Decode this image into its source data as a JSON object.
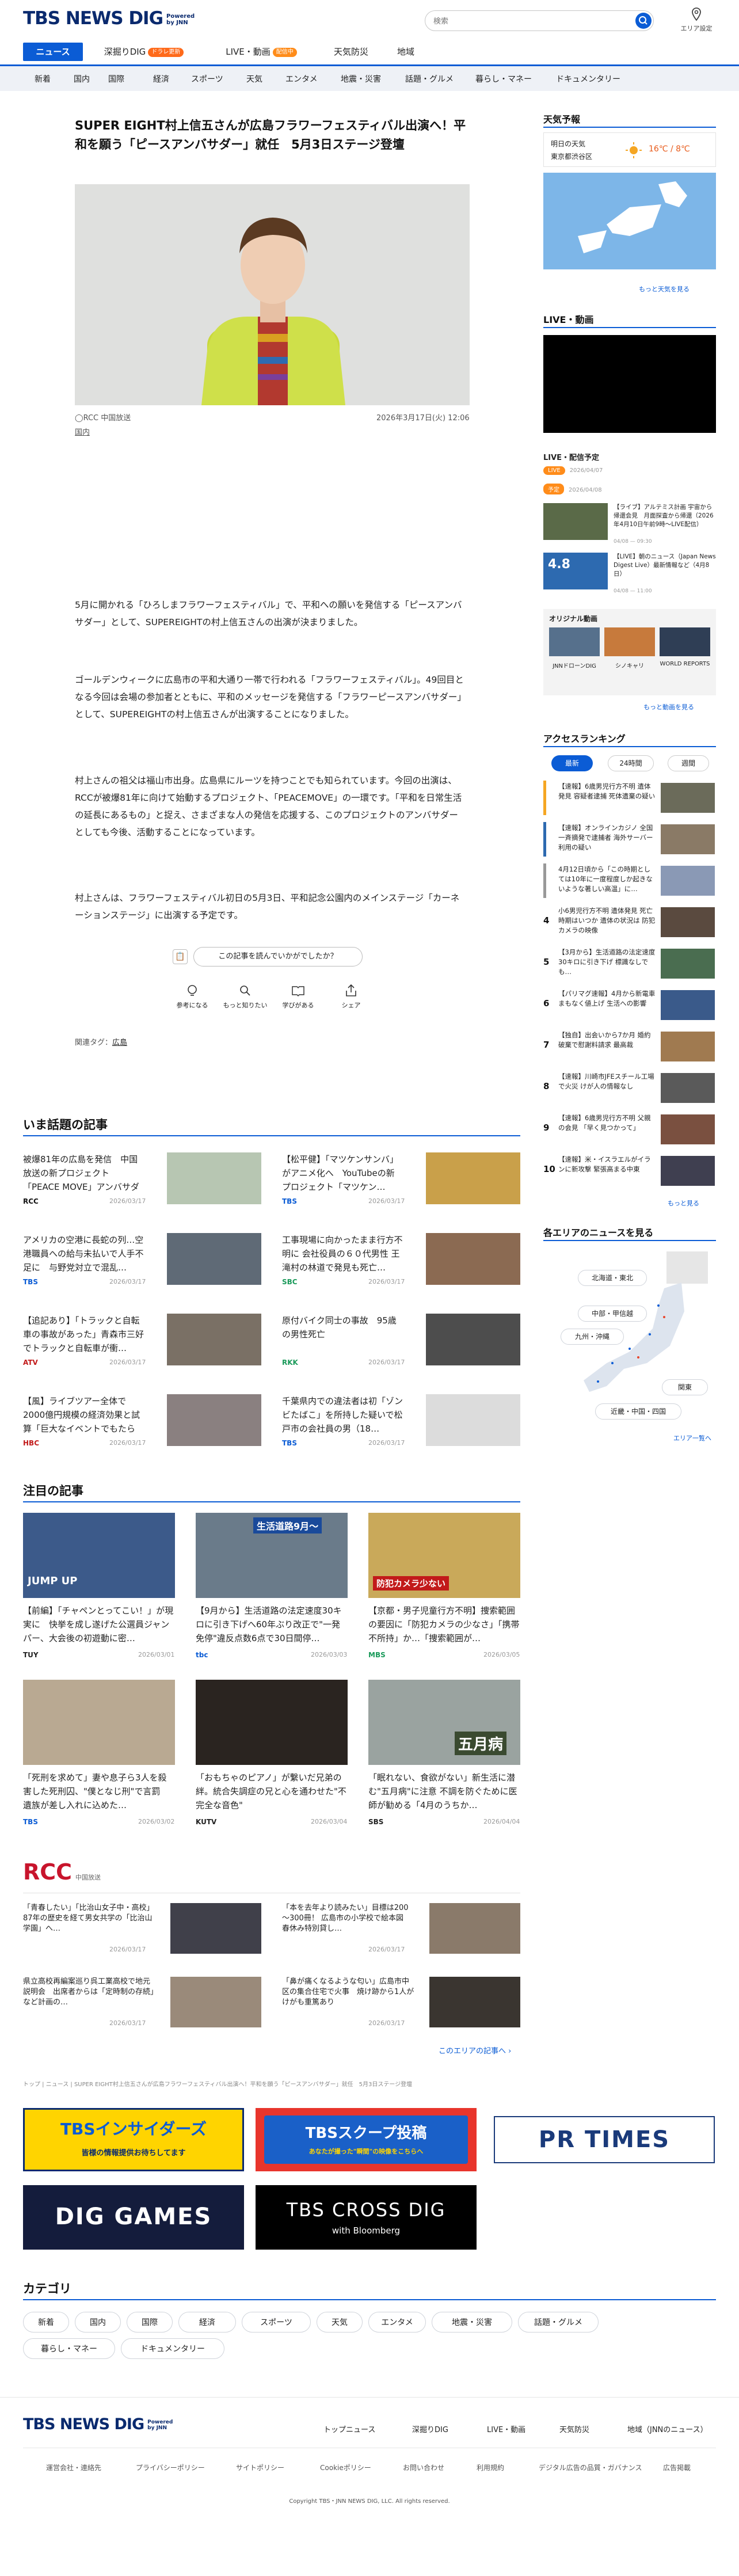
{
  "header": {
    "logo": "TBS NEWS DIG",
    "powered": "Powered by JNN",
    "search_placeholder": "検索",
    "area_label": "エリア設定"
  },
  "nav": {
    "primary": [
      {
        "label": "ニュース",
        "active": true
      },
      {
        "label": "深掘りDIG",
        "badge": "ドラレ更新"
      },
      {
        "label": "LIVE・動画",
        "badge": "配信中"
      },
      {
        "label": "天気防災"
      },
      {
        "label": "地域"
      }
    ],
    "categories": [
      "新着",
      "国内",
      "国際",
      "経済",
      "スポーツ",
      "天気",
      "エンタメ",
      "地震・災害",
      "話題・グルメ",
      "暮らし・マネー",
      "ドキュメンタリー"
    ]
  },
  "article": {
    "title": "SUPER EIGHT村上信五さんが広島フラワーフェスティバル出演へ！平和を願う「ピースアンバサダー」就任　5月3日ステージ登壇",
    "source": "RCC 中国放送",
    "date": "2026年3月17日(火) 12:06",
    "category": "国内",
    "paragraphs": [
      "5月に開かれる「ひろしまフラワーフェスティバル」で、平和への願いを発信する「ピースアンバサダー」として、SUPEREIGHTの村上信五さんの出演が決まりました。",
      "ゴールデンウィークに広島市の平和大通り一帯で行われる「フラワーフェスティバル」。49回目となる今回は会場の参加者とともに、平和のメッセージを発信する「フラワーピースアンバサダー」として、SUPEREIGHTの村上信五さんが出演することになりました。",
      "村上さんの祖父は福山市出身。広島県にルーツを持つことでも知られています。今回の出演は、RCCが被爆81年に向けて始動するプロジェクト、「PEACEMOVE」の一環です。「平和を日常生活の延長にあるもの」と捉え、さまざまな人の発信を応援する、このプロジェクトのアンバサダーとしても今後、活動することになっています。",
      "村上さんは、フラワーフェスティバル初日の5月3日、平和記念公園内のメインステージ「カーネーションステージ」に出演する予定です。"
    ],
    "feedback_prompt": "この記事を読んでいかがでしたか？",
    "reactions": [
      "参考になる",
      "もっと知りたい",
      "学びがある",
      "シェア"
    ],
    "tags_label": "関連タグ：",
    "tag": "広島"
  },
  "sidebar": {
    "weather": {
      "heading": "天気予報",
      "day": "明日の天気",
      "city": "東京都渋谷区",
      "temp": "16℃ / 8℃",
      "more": "もっと天気を見る"
    },
    "live": {
      "heading": "LIVE・動画",
      "schedule_label": "LIVE・配信予定",
      "items": [
        {
          "tag": "LIVE",
          "date": "2026/04/07",
          "title": "",
          "time": ""
        },
        {
          "tag": "予定",
          "date": "2026/04/08",
          "title": "【ライブ】アルテミス計画 宇宙から帰還会見　月面探査から帰還（2026年4月10日午前9時～LIVE配信）",
          "time": "04/08 — 09:30"
        },
        {
          "tag": "",
          "date": "",
          "title": "【LIVE】朝のニュース（Japan News Digest Live）最新情報など（4月8日）",
          "time": "04/08 — 11:00"
        }
      ],
      "original_label": "オリジナル動画",
      "originals": [
        "JNNドローンDIG",
        "シノキャリ",
        "WORLD REPORTS"
      ],
      "more": "もっと動画を見る"
    },
    "ranking": {
      "heading": "アクセスランキング",
      "tabs": [
        "最新",
        "24時間",
        "週間"
      ],
      "items": [
        "【速報】6歳男児行方不明 遺体発見 容疑者逮捕 死体遺棄の疑い",
        "【速報】オンラインカジノ 全国一斉摘発で逮捕者 海外サーバー利用の疑い",
        "4月12日頃から「この時期としては10年に一度程度しか起きないような著しい高温」に…",
        "小6男児行方不明 遺体発見 死亡時期はいつか 遺体の状況は 防犯カメラの映像",
        "【3月から】生活道路の法定速度30キロに引き下げ 標識なしでも…",
        "【パリマグ速報】4月から新電車 まもなく値上げ 生活への影響",
        "【独自】出会いから7か月 婚約破棄で慰謝料請求 最高裁",
        "【速報】川崎市JFEスチール工場で火災 けが人の情報なし",
        "【速報】6歳男児行方不明 父親の会見 「早く見つかって」",
        "【速報】米・イスラエルがイランに新攻撃 緊張高まる中東"
      ],
      "more": "もっと見る"
    },
    "area_news": {
      "heading": "各エリアのニュースを見る",
      "regions": [
        "北海道・東北",
        "中部・甲信越",
        "九州・沖縄",
        "関東",
        "近畿・中国・四国"
      ],
      "more": "エリア一覧へ"
    }
  },
  "trending": {
    "heading": "いま話題の記事",
    "items": [
      {
        "title": "被爆81年の広島を発信　中国放送の新プロジェクト「PEACE MOVE」アンバサダー…",
        "source": "RCC",
        "date": "2026/03/17"
      },
      {
        "title": "【松平健】「マツケンサンバ」がアニメ化へ　YouTubeの新プロジェクト「マツケン…",
        "source": "TBS",
        "date": "2026/03/17"
      },
      {
        "title": "アメリカの空港に長蛇の列…空港職員への給与未払いで人手不足に　与野党対立で混乱…",
        "source": "TBS",
        "date": "2026/03/17"
      },
      {
        "title": "工事現場に向かったまま行方不明に 会社役員の６０代男性 王滝村の林道で発見も死亡…",
        "source": "SBC",
        "date": "2026/03/17"
      },
      {
        "title": "【追記あり】「トラックと自転車の事故があった」青森市三好でトラックと自転車が衝…",
        "source": "ATV",
        "date": "2026/03/17"
      },
      {
        "title": "原付バイク同士の事故　95歳の男性死亡",
        "source": "RKK",
        "date": "2026/03/17"
      },
      {
        "title": "【風】ライブツアー全体で2000億円規模の経済効果と試算「巨大なイベントでもたらす…",
        "source": "HBC",
        "date": "2026/03/17"
      },
      {
        "title": "千葉県内での違法者は初「ゾンビたばこ」を所持した疑いで松戸市の会社員の男（18…",
        "source": "TBS",
        "date": "2026/03/17"
      }
    ]
  },
  "featured": {
    "heading": "注目の記事",
    "items": [
      {
        "title": "【前編】「チャペンとってこい！」が現実に　快挙を成し遂げた公選員ジャンパー、大会後の初遊動に密…",
        "source": "TUY",
        "date": "2026/03/01",
        "overlay": "JUMP UP"
      },
      {
        "title": "【9月から】生活道路の法定速度30キロに引き下げへ60年ぶり改正で\"一発免停\"違反点数6点で30日間停…",
        "source": "tbc",
        "date": "2026/03/03",
        "overlay": "生活道路9月～"
      },
      {
        "title": "【京都・男子児童行方不明】捜索範囲の要因に「防犯カメラの少なさ」「携帯不所持」か…「捜索範囲が…",
        "source": "MBS",
        "date": "2026/03/05",
        "overlay": "防犯カメラ少ない"
      },
      {
        "title": "「死刑を求めて」妻や息子ら3人を殺害した死刑囚、\"僕となじ刑\"で言罰　遺族が差し入れに込めた…",
        "source": "TBS",
        "date": "2026/03/02",
        "overlay": ""
      },
      {
        "title": "「おもちゃのピアノ」が繋いだ兄弟の絆。統合失調症の兄と心を通わせた\"不完全な音色\"",
        "source": "KUTV",
        "date": "2026/03/04",
        "overlay": ""
      },
      {
        "title": "「眠れない、食欲がない」新生活に潜む\"五月病\"に注意 不調を防ぐために医師が勧める「4月のうちか…",
        "source": "SBS",
        "date": "2026/04/04",
        "overlay": "五月病"
      }
    ]
  },
  "regional": {
    "station": "RCC",
    "station_sub": "中国放送",
    "items": [
      {
        "title": "「青春したい」｢比治山女子中・高校｣ 87年の歴史を経て男女共学の「比治山学園」へ…",
        "date": "2026/03/17"
      },
      {
        "title": "「本を去年より読みたい」目標は200～300冊！ 広島市の小学校で絵本図　春休み特別貸し…",
        "date": "2026/03/17"
      },
      {
        "title": "県立高校再編案巡り呉工業高校で地元説明会　出席者からは「定時制の存続」など計画の…",
        "date": "2026/03/17"
      },
      {
        "title": "「鼻が痛くなるような匂い」広島市中区の集合住宅で火事　焼け跡から1人がけがも重篤あり",
        "date": "2026/03/17"
      }
    ],
    "more": "このエリアの記事へ"
  },
  "breadcrumb": "トップ | ニュース | SUPER EIGHT村上信五さんが広島フラワーフェスティバル出演へ！平和を願う「ピースアンバサダー」就任　5月3日ステージ登壇",
  "banners": {
    "insiders": "TBSインサイダーズ",
    "insiders_sub": "皆様の情報提供お待ちしてます",
    "scoop": "TBSスクープ投稿",
    "scoop_sub": "あなたが撮った\"瞬間\"の映像をこちらへ",
    "prtimes": "PR TIMES",
    "games": "DIG GAMES",
    "crossdig": "TBS CROSS DIG",
    "crossdig_sub": "with Bloomberg"
  },
  "category_section": {
    "heading": "カテゴリ",
    "items": [
      "新着",
      "国内",
      "国際",
      "経済",
      "スポーツ",
      "天気",
      "エンタメ",
      "地震・災害",
      "話題・グルメ",
      "暮らし・マネー",
      "ドキュメンタリー"
    ]
  },
  "footer": {
    "logo": "TBS NEWS DIG",
    "powered": "Powered by JNN",
    "links": [
      "トップニュース",
      "深掘りDIG",
      "LIVE・動画",
      "天気防災",
      "地域（JNNのニュース）"
    ],
    "sublinks": [
      "運営会社・連絡先",
      "プライバシーポリシー",
      "サイトポリシー",
      "Cookieポリシー",
      "お問い合わせ",
      "利用規約",
      "デジタル広告の品質・ガバナンス",
      "広告掲載"
    ],
    "copyright": "Copyright TBS・JNN NEWS DIG, LLC. All rights reserved."
  },
  "colors": {
    "brand": "#0a2a6e",
    "accent": "#0b5cd5",
    "orange": "#ff6a1a",
    "live": "#ff8c1a"
  }
}
